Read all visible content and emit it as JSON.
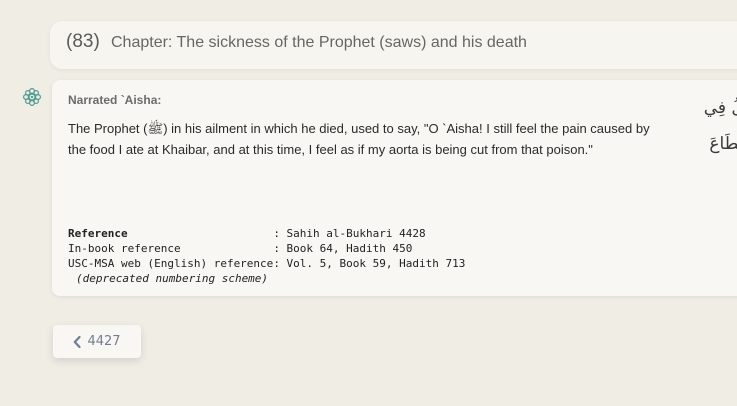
{
  "chapter": {
    "number": "(83)",
    "title": "Chapter: The sickness of the Prophet (saws) and his death"
  },
  "hadith": {
    "narrator": "Narrated `Aisha:",
    "text": "The Prophet (ﷺ) in his ailment in which he died, used to say, \"O `Aisha! I still feel the pain caused by the food I ate at Khaibar, and at this time, I feel as if my aorta is being cut from that poison.\"",
    "arabic_line1": "ولُ فِي",
    "arabic_line2": "نِقِطَاعَ",
    "icon": "ornament-flower-icon"
  },
  "reference": {
    "rows": [
      {
        "label": "Reference",
        "value": ": Sahih al-Bukhari 4428"
      },
      {
        "label": "In-book reference",
        "value": ": Book 64, Hadith 450"
      },
      {
        "label": "USC-MSA web (English) reference",
        "value": ": Vol. 5, Book 59, Hadith 713"
      }
    ],
    "note": "(deprecated numbering scheme)"
  },
  "navigation": {
    "prev_label": "4427",
    "prev_icon": "chevron-left-icon"
  },
  "colors": {
    "background": "#efede4",
    "card": "#f8f7f3",
    "accent": "#4e9a90",
    "nav_text": "#6f7f91"
  }
}
